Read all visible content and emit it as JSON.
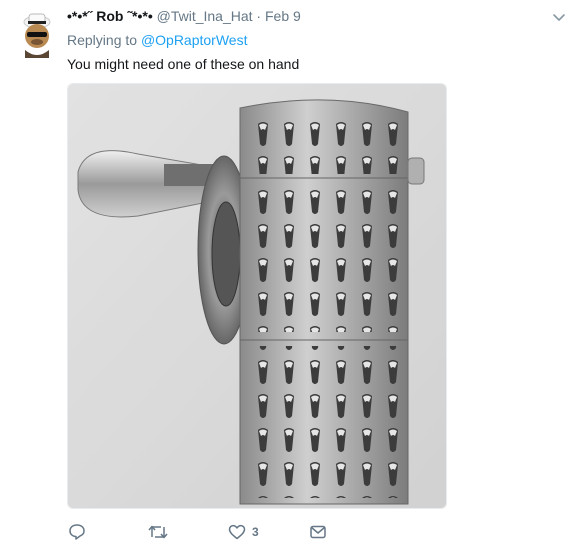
{
  "tweet": {
    "display_name": "•*•*˝ Rob ˜*•*•",
    "handle": "@Twit_Ina_Hat",
    "separator": "·",
    "time": "Feb 9",
    "reply_prefix": "Replying to",
    "reply_to": "@OpRaptorWest",
    "text": "You might need one of these on hand"
  },
  "actions": {
    "reply_count": "",
    "retweet_count": "",
    "like_count": "3",
    "dm_count": ""
  },
  "icons": {
    "avatar": "avatar-cartoon-face-with-hat",
    "menu": "chevron-down-icon",
    "reply": "reply-icon",
    "retweet": "retweet-icon",
    "like": "heart-icon",
    "dm": "message-icon"
  },
  "colors": {
    "link": "#1da1f2",
    "meta": "#657786",
    "text": "#14171a"
  }
}
